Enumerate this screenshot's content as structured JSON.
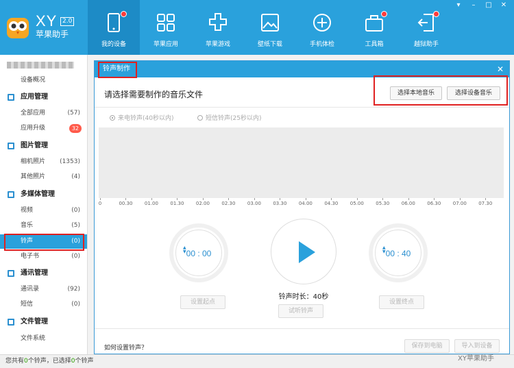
{
  "app": {
    "brand": "XY",
    "version": "2.0",
    "name": "苹果助手"
  },
  "nav": [
    {
      "label": "我的设备",
      "icon": "phone-icon",
      "dot": true
    },
    {
      "label": "苹果应用",
      "icon": "apps-grid-icon",
      "dot": false
    },
    {
      "label": "苹果游戏",
      "icon": "game-cross-icon",
      "dot": false
    },
    {
      "label": "壁纸下载",
      "icon": "picture-icon",
      "dot": false
    },
    {
      "label": "手机体检",
      "icon": "plus-circle-icon",
      "dot": false
    },
    {
      "label": "工具箱",
      "icon": "toolbox-icon",
      "dot": true
    },
    {
      "label": "越狱助手",
      "icon": "exit-arrow-icon",
      "dot": true
    }
  ],
  "sidebar": {
    "overview": "设备概况",
    "app_group": "应用管理",
    "all_apps": {
      "label": "全部应用",
      "count": "(57)"
    },
    "app_upgrade": {
      "label": "应用升级",
      "badge": "32"
    },
    "pic_group": "图片管理",
    "camera": {
      "label": "相机照片",
      "count": "(1353)"
    },
    "other_pics": {
      "label": "其他照片",
      "count": "(4)"
    },
    "media_group": "多媒体管理",
    "video": {
      "label": "视频",
      "count": "(0)"
    },
    "music": {
      "label": "音乐",
      "count": "(5)"
    },
    "ringtone": {
      "label": "铃声",
      "count": "(0)"
    },
    "ebook": {
      "label": "电子书",
      "count": "(0)"
    },
    "comm_group": "通讯管理",
    "contacts": {
      "label": "通讯录",
      "count": "(92)"
    },
    "sms": {
      "label": "短信",
      "count": "(0)"
    },
    "file_group": "文件管理",
    "filesystem": "文件系统"
  },
  "status": {
    "p1": "您共有",
    "n1": "0",
    "p2": "个铃声，已选择",
    "n2": "0",
    "p3": "个铃声"
  },
  "dialog": {
    "title": "铃声制作",
    "heading": "请选择需要制作的音乐文件",
    "btn_local": "选择本地音乐",
    "btn_device": "选择设备音乐",
    "radio_call": "来电铃声(40秒以内)",
    "radio_sms": "短信铃声(25秒以内)",
    "ticks": [
      "0",
      "00.30",
      "01.00",
      "01.30",
      "02.00",
      "02.30",
      "03.00",
      "03.30",
      "04.00",
      "04.30",
      "05.00",
      "05.30",
      "06.00",
      "06.30",
      "07.00",
      "07.30"
    ],
    "start_time": "00 : 00",
    "end_time": "00 : 40",
    "btn_set_start": "设置起点",
    "btn_set_end": "设置终点",
    "duration": "铃声时长：40秒",
    "btn_preview": "试听铃声",
    "help": "如何设置铃声？",
    "btn_save_pc": "保存到电脑",
    "btn_import": "导入到设备"
  },
  "watermark": "XY苹果助手"
}
